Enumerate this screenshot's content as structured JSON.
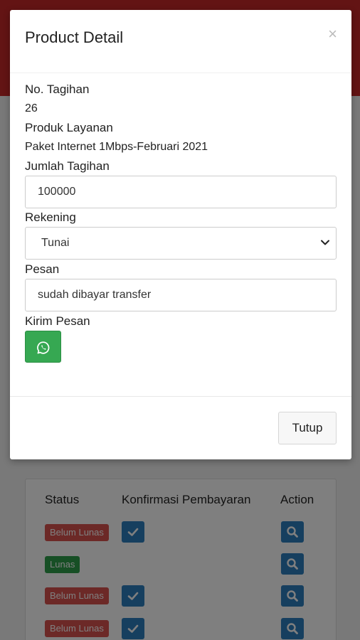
{
  "modal": {
    "title": "Product Detail",
    "close": "×",
    "no_tagihan_label": "No. Tagihan",
    "no_tagihan_value": "26",
    "produk_label": "Produk Layanan",
    "produk_value": "Paket Internet 1Mbps-Februari 2021",
    "jumlah_label": "Jumlah Tagihan",
    "jumlah_value": "100000",
    "rekening_label": "Rekening",
    "rekening_value": "Tunai",
    "pesan_label": "Pesan",
    "pesan_value": "sudah dibayar transfer",
    "kirim_label": "Kirim Pesan",
    "kirim_icon": "whatsapp-icon",
    "close_button": "Tutup"
  },
  "table": {
    "headers": [
      "Status",
      "Konfirmasi Pembayaran",
      "Action"
    ],
    "rows": [
      {
        "status": "Belum Lunas",
        "status_color": "#d9534f",
        "confirm": true
      },
      {
        "status": "Lunas",
        "status_color": "#2e9e4a",
        "confirm": false
      },
      {
        "status": "Belum Lunas",
        "status_color": "#d9534f",
        "confirm": true
      },
      {
        "status": "Belum Lunas",
        "status_color": "#d9534f",
        "confirm": true
      }
    ]
  },
  "colors": {
    "header_red": "#c62828",
    "whatsapp_green": "#36a852",
    "action_blue": "#2d7fbf"
  }
}
